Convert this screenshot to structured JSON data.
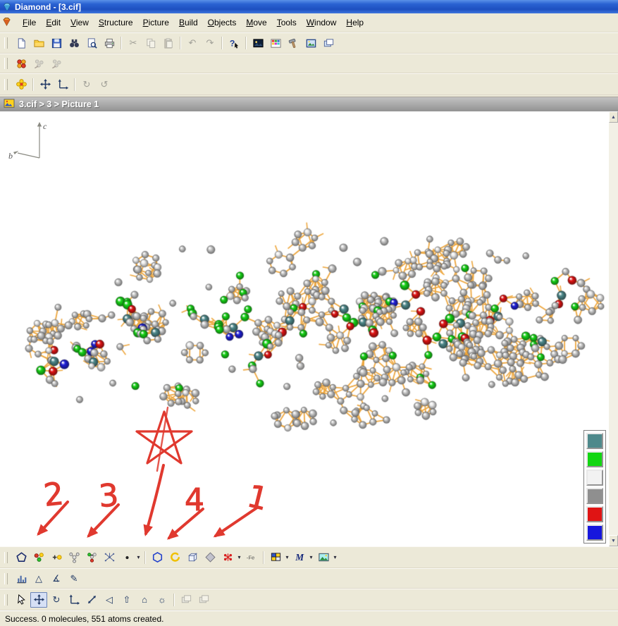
{
  "window": {
    "title": "Diamond - [3.cif]"
  },
  "menu": {
    "items": [
      "File",
      "Edit",
      "View",
      "Structure",
      "Picture",
      "Build",
      "Objects",
      "Move",
      "Tools",
      "Window",
      "Help"
    ]
  },
  "breadcrumb": {
    "text": "3.cif > 3 > Picture 1"
  },
  "axis": {
    "labels": [
      "c",
      "b"
    ]
  },
  "scroll": {
    "up": "▲",
    "down": "▼"
  },
  "legend": {
    "items": [
      {
        "name": "teal",
        "color": "#4e898b"
      },
      {
        "name": "green",
        "color": "#12d612"
      },
      {
        "name": "white",
        "color": "#f2f2f2"
      },
      {
        "name": "gray",
        "color": "#8f8f8f"
      },
      {
        "name": "red",
        "color": "#e01414"
      },
      {
        "name": "blue",
        "color": "#1616dd"
      }
    ]
  },
  "statusbar": {
    "text": "Success. 0 molecules, 551 atoms created."
  },
  "annotations": {
    "labels": [
      "2",
      "3",
      "4",
      "1"
    ],
    "color": "#e0392f"
  },
  "molecule": {
    "atom_count": 551,
    "bond_color": "#eda73f",
    "palette": {
      "teal": "#4e898b",
      "green": "#17d317",
      "red": "#e01414",
      "blue": "#2020d8",
      "gray": "#cacaca",
      "white": "#ebebeb"
    }
  },
  "toolbars": {
    "main": [
      {
        "name": "new-file-button",
        "icon": "doc"
      },
      {
        "name": "open-button",
        "icon": "folder"
      },
      {
        "name": "save-button",
        "icon": "floppy"
      },
      {
        "name": "find-button",
        "icon": "binoculars"
      },
      {
        "name": "print-preview-button",
        "icon": "preview"
      },
      {
        "name": "print-button",
        "icon": "printer"
      },
      {
        "sep": true
      },
      {
        "name": "cut-button",
        "glyph": "✂",
        "disabled": true
      },
      {
        "name": "copy-button",
        "icon": "copy",
        "disabled": true
      },
      {
        "name": "paste-button",
        "icon": "paste",
        "disabled": true
      },
      {
        "sep": true
      },
      {
        "name": "undo-button",
        "glyph": "↶",
        "disabled": true
      },
      {
        "name": "redo-button",
        "glyph": "↷",
        "disabled": true
      },
      {
        "sep": true
      },
      {
        "name": "context-help-button",
        "icon": "help"
      },
      {
        "sep": true
      },
      {
        "name": "render-scene-button",
        "icon": "imagedark"
      },
      {
        "name": "periodic-table-button",
        "icon": "gridcolored"
      },
      {
        "name": "tools-button",
        "icon": "hammer"
      },
      {
        "name": "picture-frame-button",
        "icon": "framed"
      },
      {
        "name": "gallery-button",
        "icon": "stack"
      }
    ],
    "structure": [
      {
        "name": "create-structure-button",
        "icon": "flower4"
      },
      {
        "name": "add-molecule-button",
        "icon": "molarrow",
        "disabled": true
      },
      {
        "name": "complete-molecule-button",
        "icon": "molarrow",
        "disabled": true
      }
    ],
    "move": [
      {
        "name": "packing-flower-button",
        "icon": "floweryellow"
      },
      {
        "sep": true
      },
      {
        "name": "pan-view-button",
        "icon": "pan"
      },
      {
        "name": "axes-move-button",
        "icon": "axesmove"
      },
      {
        "sep": true
      },
      {
        "name": "rotate-view-button",
        "glyph": "↻",
        "disabled": true
      },
      {
        "name": "spin-view-button",
        "glyph": "↺",
        "disabled": true
      }
    ],
    "picture": [
      {
        "name": "polygon-tool-button",
        "icon": "pentagon"
      },
      {
        "name": "get-molecules-button",
        "icon": "molecules3"
      },
      {
        "name": "add-atoms-button",
        "icon": "plusatom"
      },
      {
        "name": "complete-fragments-button",
        "icon": "molecule4"
      },
      {
        "name": "fill-cell-button",
        "icon": "packing"
      },
      {
        "name": "coordination-spheres-button",
        "icon": "network"
      },
      {
        "name": "atom-design-button",
        "icon": "dot",
        "dropdown": true
      },
      {
        "sep": true
      },
      {
        "name": "build-ring-button",
        "icon": "hexagon"
      },
      {
        "name": "broken-ring-button",
        "icon": "ring"
      },
      {
        "name": "unit-cell-button",
        "icon": "cube"
      },
      {
        "name": "polyhedra-button",
        "icon": "diamondgray"
      },
      {
        "name": "destroy-adjust-button",
        "icon": "redburst",
        "dropdown": true
      },
      {
        "name": "element-filter-button",
        "icon": "fe",
        "label": "-Fe"
      },
      {
        "sep": true
      },
      {
        "name": "table-view-button",
        "icon": "grid4",
        "dropdown": true
      },
      {
        "name": "label-style-button",
        "icon": "mletter",
        "label": "M",
        "dropdown": true
      },
      {
        "name": "picture-style-button",
        "icon": "picture",
        "dropdown": true
      }
    ],
    "measure": [
      {
        "name": "powder-pattern-button",
        "icon": "bars"
      },
      {
        "name": "distance-button",
        "glyph": "△"
      },
      {
        "name": "angle-button",
        "glyph": "∡"
      },
      {
        "name": "sketch-button",
        "glyph": "✎"
      }
    ],
    "view": [
      {
        "name": "select-tool-button",
        "icon": "pointer"
      },
      {
        "name": "move-tool-button",
        "icon": "pan",
        "selected": true
      },
      {
        "name": "rotate-tool-button",
        "glyph": "↻"
      },
      {
        "name": "translate-tool-button",
        "icon": "axesmove"
      },
      {
        "name": "zoom-tool-button",
        "icon": "zoomarrows"
      },
      {
        "name": "tilt-tool-button",
        "glyph": "◁"
      },
      {
        "name": "shift-tool-button",
        "glyph": "⇧"
      },
      {
        "name": "home-view-button",
        "glyph": "⌂"
      },
      {
        "name": "track-view-button",
        "glyph": "☼"
      },
      {
        "sep": true
      },
      {
        "name": "orientation-prev-button",
        "icon": "stack",
        "disabled": true
      },
      {
        "name": "orientation-next-button",
        "icon": "stack",
        "disabled": true
      }
    ]
  }
}
